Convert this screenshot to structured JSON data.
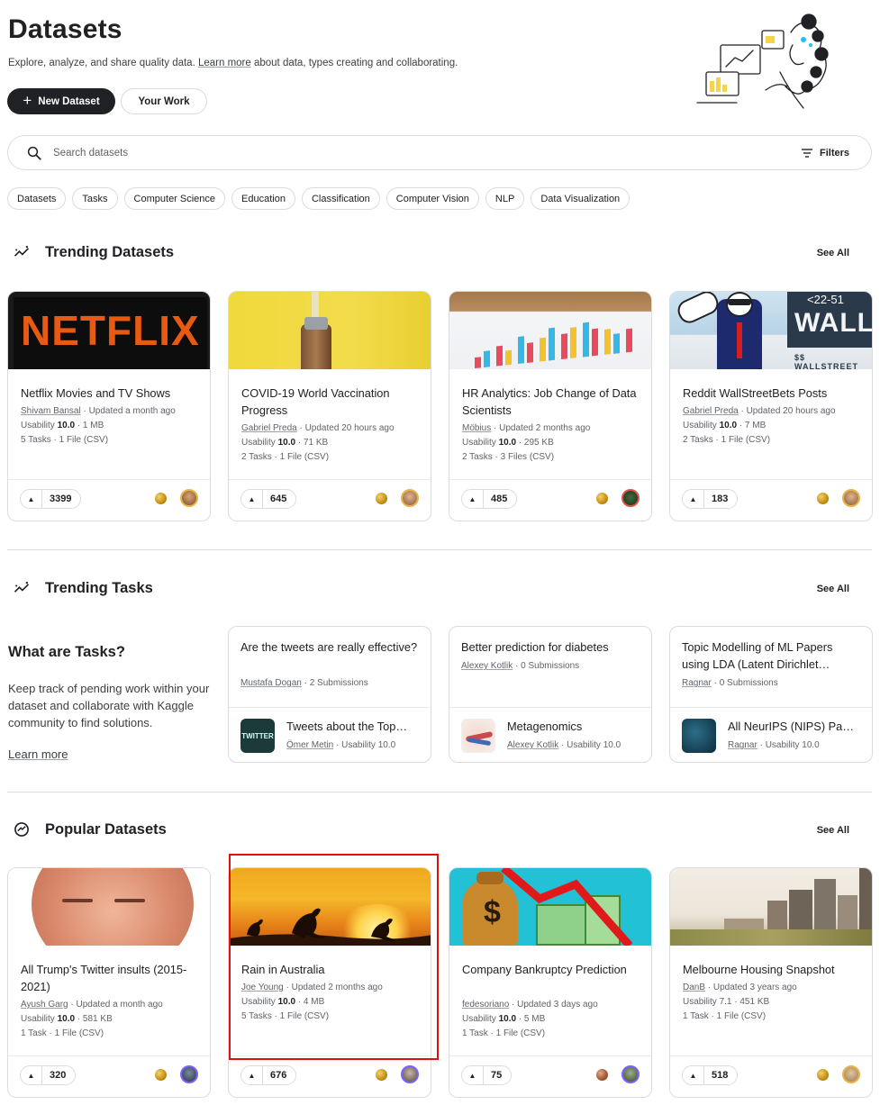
{
  "header": {
    "title": "Datasets",
    "subtitle_pre": "Explore, analyze, and share quality data. ",
    "subtitle_link": "Learn more",
    "subtitle_post": " about data, types creating and collaborating.",
    "new_dataset_label": "New Dataset",
    "your_work_label": "Your Work"
  },
  "search": {
    "placeholder": "Search datasets",
    "filters_label": "Filters"
  },
  "chips": [
    "Datasets",
    "Tasks",
    "Computer Science",
    "Education",
    "Classification",
    "Computer Vision",
    "NLP",
    "Data Visualization"
  ],
  "trending_datasets": {
    "heading": "Trending Datasets",
    "see_all": "See All",
    "cards": [
      {
        "title": "Netflix Movies and TV Shows",
        "author": "Shivam Bansal",
        "updated": " · Updated a month ago",
        "usability": "10.0",
        "size": " · 1 MB",
        "files": "5 Tasks · 1 File (CSV)",
        "votes": "3399"
      },
      {
        "title": "COVID-19 World Vaccination Progress",
        "author": "Gabriel Preda",
        "updated": " · Updated 20 hours ago",
        "usability": "10.0",
        "size": " · 71 KB",
        "files": "2 Tasks · 1 File (CSV)",
        "votes": "645"
      },
      {
        "title": "HR Analytics: Job Change of Data Scientists",
        "author": "Möbius",
        "updated": " · Updated 2 months ago",
        "usability": "10.0",
        "size": " · 295 KB",
        "files": "2 Tasks · 3 Files (CSV)",
        "votes": "485"
      },
      {
        "title": "Reddit WallStreetBets Posts",
        "author": "Gabriel Preda",
        "updated": " · Updated 20 hours ago",
        "usability": "10.0",
        "size": " · 7 MB",
        "files": "2 Tasks · 1 File (CSV)",
        "votes": "183"
      }
    ]
  },
  "trending_tasks": {
    "heading": "Trending Tasks",
    "see_all": "See All",
    "intro_title": "What are Tasks?",
    "intro_text": "Keep track of pending work within your dataset and collaborate with Kaggle community to find solutions.",
    "intro_link": "Learn more",
    "cards": [
      {
        "title": "Are the tweets are really effective?",
        "author": "Mustafa Dogan",
        "submissions": " · 2 Submissions",
        "dataset": "Tweets about the Top…",
        "dataset_author": "Ömer Metin",
        "dataset_usability": " · Usability 10.0",
        "thumb_text": "TWITTER"
      },
      {
        "title": "Better prediction for diabetes",
        "author": "Alexey Kotlik",
        "submissions": " · 0 Submissions",
        "dataset": "Metagenomics",
        "dataset_author": "Alexey Kotlik",
        "dataset_usability": " · Usability 10.0",
        "thumb_text": ""
      },
      {
        "title": "Topic Modelling of ML Papers using LDA (Latent Dirichlet…",
        "author": "Ragnar",
        "submissions": " · 0 Submissions",
        "dataset": "All NeurIPS (NIPS) Pa…",
        "dataset_author": "Ragnar",
        "dataset_usability": " · Usability 10.0",
        "thumb_text": ""
      }
    ]
  },
  "popular_datasets": {
    "heading": "Popular Datasets",
    "see_all": "See All",
    "cards": [
      {
        "title": "All Trump's Twitter insults (2015-2021)",
        "author": "Ayush Garg",
        "updated": " · Updated a month ago",
        "usability": "10.0",
        "size": " · 581 KB",
        "files": "1 Task · 1 File (CSV)",
        "votes": "320"
      },
      {
        "title": "Rain in Australia",
        "author": "Joe Young",
        "updated": " · Updated 2 months ago",
        "usability": "10.0",
        "size": " · 4 MB",
        "files": "5 Tasks · 1 File (CSV)",
        "votes": "676"
      },
      {
        "title": "Company Bankruptcy Prediction",
        "author": "fedesoriano",
        "updated": " · Updated 3 days ago",
        "usability": "10.0",
        "size": " · 5 MB",
        "files": "1 Task · 1 File (CSV)",
        "votes": "75"
      },
      {
        "title": "Melbourne Housing Snapshot",
        "author": "DanB",
        "updated": " · Updated 3 years ago",
        "usability": "7.1",
        "size": " · 451 KB",
        "files": "1 Task · 1 File (CSV)",
        "votes": "518"
      }
    ]
  },
  "thumb_texts": {
    "netflix": "NETFLIX",
    "wallst": "WALL",
    "wallst_sign": "$$ WALLSTREET",
    "ticker": "<22-51",
    "dollar": "$"
  },
  "labels": {
    "usability_prefix": "Usability "
  },
  "colors": {
    "primary_dark": "#202124",
    "border": "#dadce0",
    "highlight": "#e01010"
  }
}
